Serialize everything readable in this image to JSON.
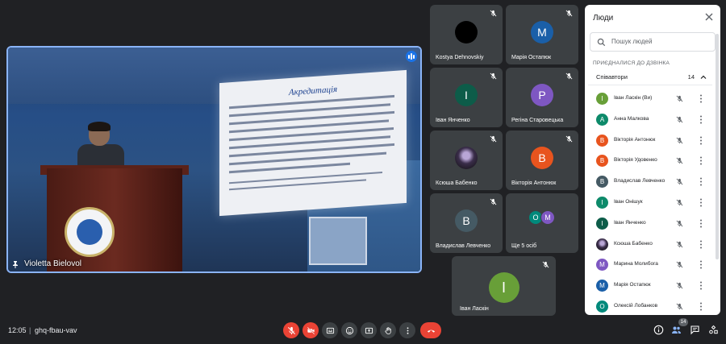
{
  "presenter": {
    "name": "Violetta Bielovol"
  },
  "slide": {
    "title": "Акредитація"
  },
  "tiles": [
    {
      "name": "Kostya Dehnovskiy",
      "letter": "",
      "color": "#000000"
    },
    {
      "name": "Марія Остапюк",
      "letter": "M",
      "color": "#1a5fa8"
    },
    {
      "name": "Іван Янченко",
      "letter": "I",
      "color": "#0d5c49"
    },
    {
      "name": "Регіна Старовецька",
      "letter": "P",
      "color": "#7e57c2"
    },
    {
      "name": "Ксюша Бабенко",
      "letter": "",
      "color": "#3a2d4a"
    },
    {
      "name": "Вікторія Антонюк",
      "letter": "B",
      "color": "#e8541e"
    },
    {
      "name": "Владислав Левченко",
      "letter": "B",
      "color": "#455a64"
    },
    {
      "name": "Ще 5 осіб",
      "letter": "",
      "color": ""
    }
  ],
  "more_avatars": [
    {
      "letter": "O",
      "color": "#00897b"
    },
    {
      "letter": "M",
      "color": "#7e57c2"
    }
  ],
  "self_tile": {
    "name": "Іван Ласкін",
    "letter": "I",
    "color": "#689f38"
  },
  "panel": {
    "title": "Люди",
    "search_placeholder": "Пошук людей",
    "section": "ПРИЄДНАЛИСЯ ДО ДЗВІНКА",
    "group_label": "Співавтори",
    "group_count": "14",
    "people": [
      {
        "name": "Іван Ласкін (Ви)",
        "letter": "I",
        "color": "#689f38"
      },
      {
        "name": "Анна Малкова",
        "letter": "A",
        "color": "#0d8a6a"
      },
      {
        "name": "Вікторія Антонюк",
        "letter": "B",
        "color": "#e8541e"
      },
      {
        "name": "Вікторія Удовенко",
        "letter": "B",
        "color": "#e8541e"
      },
      {
        "name": "Владислав Левченко",
        "letter": "B",
        "color": "#455a64"
      },
      {
        "name": "Іван Онішук",
        "letter": "I",
        "color": "#0d8a6a"
      },
      {
        "name": "Іван Янченко",
        "letter": "I",
        "color": "#0d5c49"
      },
      {
        "name": "Ксюша Бабенко",
        "letter": "",
        "color": "#3a2d4a"
      },
      {
        "name": "Марина Молибога",
        "letter": "M",
        "color": "#7e57c2"
      },
      {
        "name": "Марія Остапюк",
        "letter": "M",
        "color": "#1a5fa8"
      },
      {
        "name": "Олексій Лобанков",
        "letter": "O",
        "color": "#00897b"
      }
    ]
  },
  "bottom": {
    "time": "12:05",
    "separator": "|",
    "meeting_code": "ghq-fbau-vav",
    "people_badge": "14"
  }
}
